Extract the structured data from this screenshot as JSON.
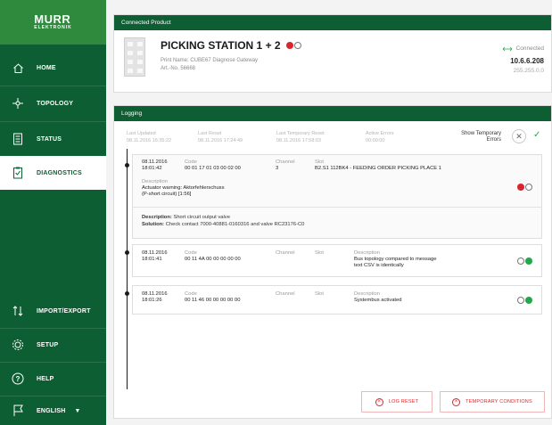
{
  "brand": {
    "name": "MURR",
    "subname": "ELEKTRONIK"
  },
  "nav": {
    "home": "HOME",
    "topology": "TOPOLOGY",
    "status": "STATUS",
    "diagnostics": "DIAGNOSTICS",
    "import_export": "IMPORT/EXPORT",
    "setup": "SETUP",
    "help": "HELP",
    "language": "ENGLISH"
  },
  "product": {
    "header": "Connected Product",
    "title": "PICKING STATION 1 + 2",
    "print_name": "Print Name: CUBE67 Diagnose Gateway",
    "art_no": "Art.-No. 56668",
    "connection": "Connected",
    "ip": "10.6.6.208",
    "mask": "255.255.0.0"
  },
  "logging": {
    "header": "Logging",
    "stats": [
      {
        "label": "Last Updated",
        "value": "08.11.2016 16:35:22"
      },
      {
        "label": "Last Reset",
        "value": "08.11.2016 17:24:49"
      },
      {
        "label": "Last Temporary Reset",
        "value": "08.11.2016 17:58:03"
      },
      {
        "label": "Active Errors",
        "value": "00:00:00"
      }
    ],
    "show_temporary": "Show Temporary Errors",
    "entries": [
      {
        "date": "08.11.2016",
        "time": "18:01:42",
        "code_label": "Code",
        "code": "00 01 17 01 03 00 02 00",
        "channel_label": "Channel",
        "channel": "3",
        "slot_label": "Slot",
        "slot": "B2.S1 112BK4 - FEEDING ORDER PICKING PLACE 1",
        "desc_label": "Description",
        "desc_line1": "Actuator warning: Aktorfehlerschuss",
        "desc_line2": "(P-short circuit) [1:56]",
        "detail_desc_label": "Description:",
        "detail_desc": "Short circuit output valve",
        "detail_sol_label": "Solution:",
        "detail_sol": "Check contact 7000-40881-0160316 and valve RC23176-C0"
      },
      {
        "date": "08.11.2016",
        "time": "18:01:41",
        "code_label": "Code",
        "code": "00 11 4A 00 00 00 00 00",
        "channel_label": "Channel",
        "slot_label": "Slot",
        "desc_label": "Description",
        "desc_line1": "Bus topology compared to message",
        "desc_line2": "text CSV is identically"
      },
      {
        "date": "08.11.2016",
        "time": "18:01:26",
        "code_label": "Code",
        "code": "00 11 46 00 00 00 00 00",
        "channel_label": "Channel",
        "slot_label": "Slot",
        "desc_label": "Description",
        "desc_line1": "Systembus activated"
      }
    ],
    "log_reset": "LOG RESET",
    "temporary_conditions": "TEMPORARY CONDITIONS"
  },
  "colors": {
    "sidebar": "#0d5f33",
    "logo_bg": "#2f8a3e",
    "error": "#d9262c",
    "ok": "#20a84a"
  }
}
